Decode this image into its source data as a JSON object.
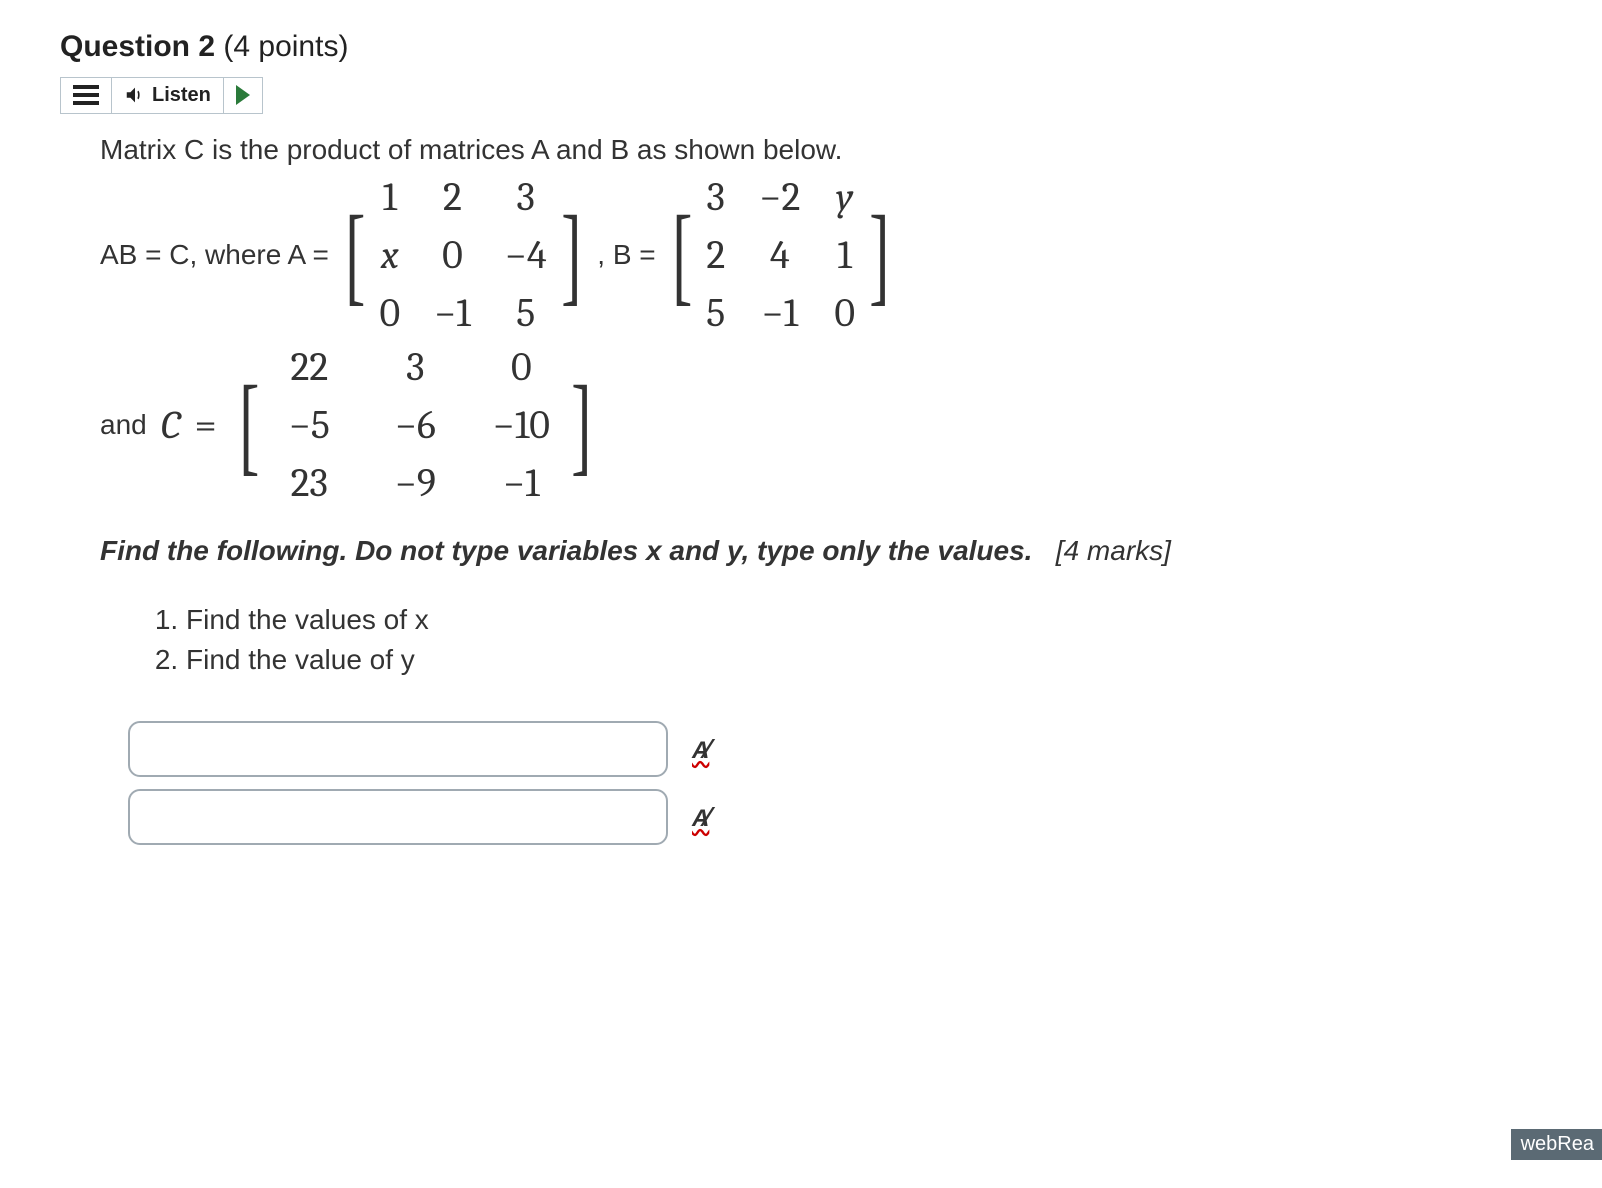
{
  "header": {
    "question_label": "Question 2",
    "points_label": "(4 points)"
  },
  "toolbar": {
    "listen_label": "Listen"
  },
  "body": {
    "intro": "Matrix C is the product of matrices A and B as shown below.",
    "equation_prefix": "AB = C, where A =",
    "matrix_A": [
      [
        "1",
        "2",
        "3"
      ],
      [
        "x",
        "0",
        "−4"
      ],
      [
        "0",
        "−1",
        "5"
      ]
    ],
    "between_AB": ", B =",
    "matrix_B": [
      [
        "3",
        "−2",
        "y"
      ],
      [
        "2",
        "4",
        "1"
      ],
      [
        "5",
        "−1",
        "0"
      ]
    ],
    "and_label": "and",
    "C_symbol": "C",
    "equals": "=",
    "matrix_C": [
      [
        "22",
        "3",
        "0"
      ],
      [
        "−5",
        "−6",
        "−10"
      ],
      [
        "23",
        "−9",
        "−1"
      ]
    ],
    "instruction_bold": "Find the following. Do not type variables x and y, type only the values.",
    "instruction_marks": "[4 marks]",
    "subquestions": [
      "Find the values of x",
      "Find the value of y"
    ]
  },
  "footer_badge": "webRea"
}
